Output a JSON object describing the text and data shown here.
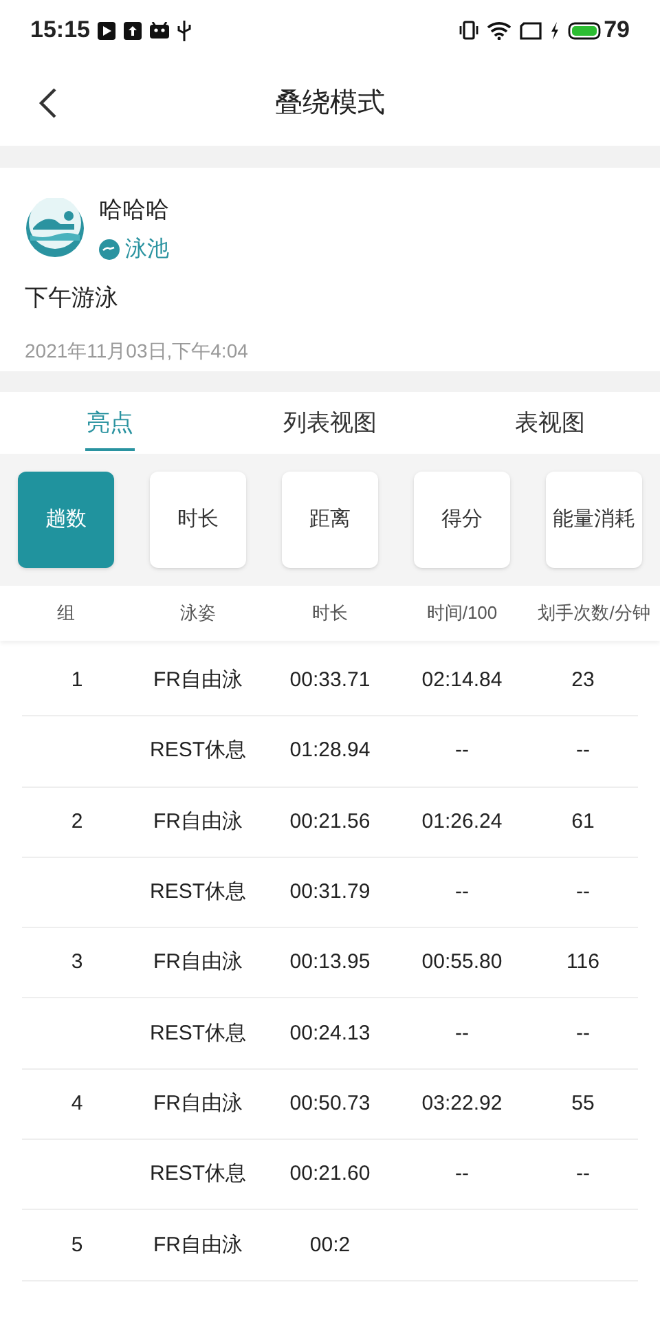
{
  "status_bar": {
    "time": "15:15",
    "battery": "79"
  },
  "header": {
    "title": "叠绕模式"
  },
  "activity": {
    "user": "哈哈哈",
    "place": "泳池",
    "title": "下午游泳",
    "date": "2021年11月03日,下午4:04"
  },
  "tabs": [
    {
      "label": "亮点",
      "selected": true
    },
    {
      "label": "列表视图",
      "selected": false
    },
    {
      "label": "表视图",
      "selected": false
    }
  ],
  "filters": [
    {
      "label": "趟数",
      "selected": true
    },
    {
      "label": "时长",
      "selected": false
    },
    {
      "label": "距离",
      "selected": false
    },
    {
      "label": "得分",
      "selected": false
    },
    {
      "label": "能量消耗",
      "selected": false
    }
  ],
  "table": {
    "columns": [
      "组",
      "泳姿",
      "时长",
      "时间/100",
      "划手次数/分钟"
    ],
    "rows": [
      [
        "1",
        "FR自由泳",
        "00:33.71",
        "02:14.84",
        "23"
      ],
      [
        "",
        "REST休息",
        "01:28.94",
        "--",
        "--"
      ],
      [
        "2",
        "FR自由泳",
        "00:21.56",
        "01:26.24",
        "61"
      ],
      [
        "",
        "REST休息",
        "00:31.79",
        "--",
        "--"
      ],
      [
        "3",
        "FR自由泳",
        "00:13.95",
        "00:55.80",
        "116"
      ],
      [
        "",
        "REST休息",
        "00:24.13",
        "--",
        "--"
      ],
      [
        "4",
        "FR自由泳",
        "00:50.73",
        "03:22.92",
        "55"
      ],
      [
        "",
        "REST休息",
        "00:21.60",
        "--",
        "--"
      ],
      [
        "5",
        "FR自由泳",
        "00:2",
        "",
        ""
      ]
    ]
  }
}
